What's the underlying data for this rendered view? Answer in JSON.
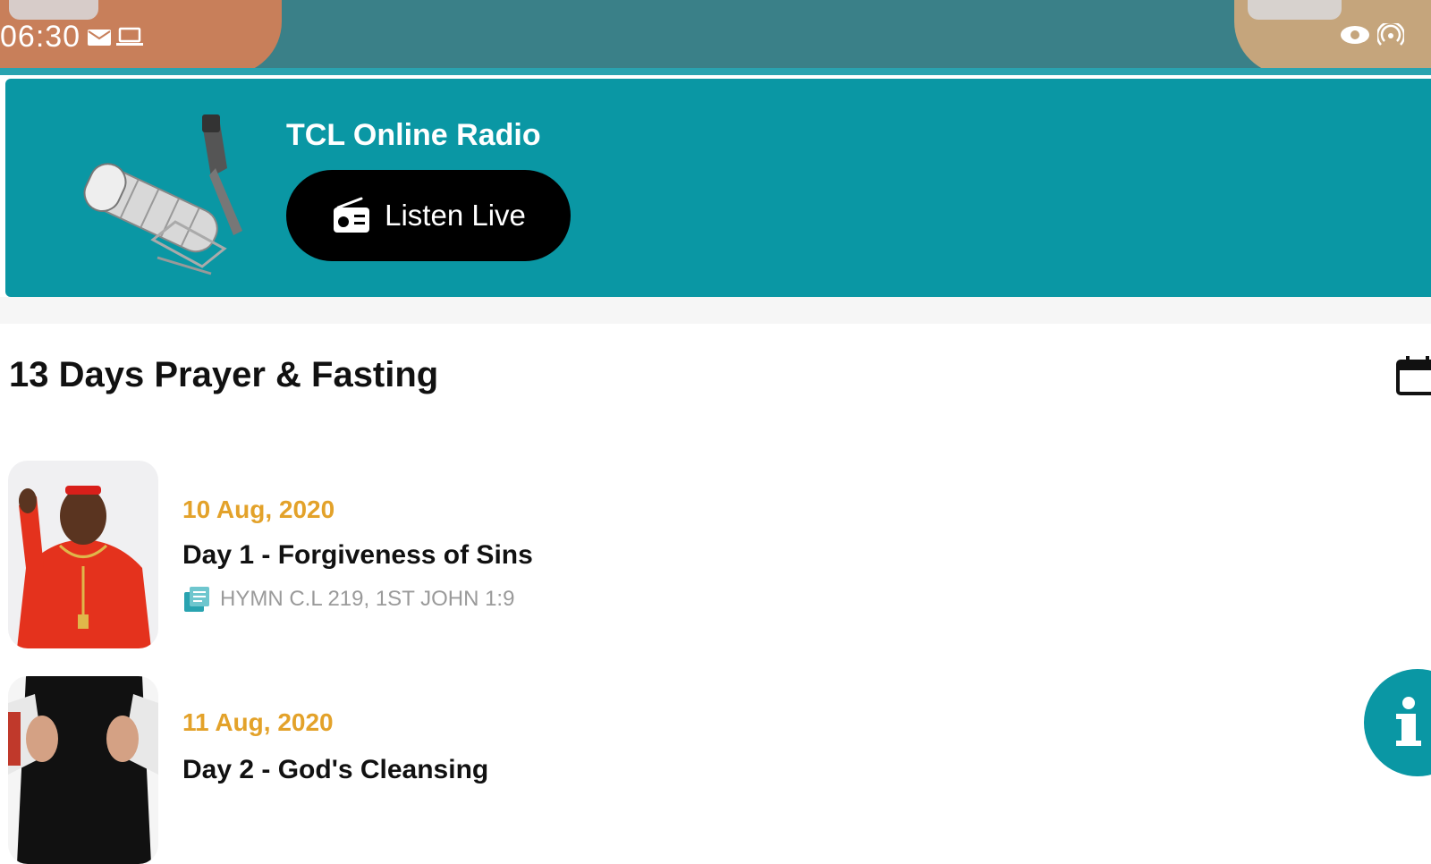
{
  "status_bar": {
    "time": "06:30",
    "icons": [
      "mail-icon",
      "laptop-icon",
      "eye-icon",
      "hotspot-icon"
    ]
  },
  "banner": {
    "title": "TCL Online Radio",
    "button_label": "Listen Live",
    "background_color": "#0a97a4"
  },
  "section": {
    "title": "13 Days Prayer & Fasting"
  },
  "items": [
    {
      "date": "10 Aug, 2020",
      "title": "Day 1 - Forgiveness of Sins",
      "reference": "HYMN C.L 219, 1ST JOHN 1:9"
    },
    {
      "date": "11 Aug, 2020",
      "title": "Day 2 - God's Cleansing"
    }
  ],
  "colors": {
    "accent": "#0a97a4",
    "date": "#e3a22a"
  }
}
